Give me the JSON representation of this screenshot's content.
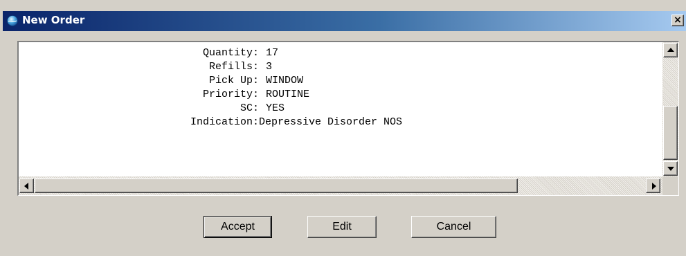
{
  "window": {
    "title": "New Order",
    "close_label": "×",
    "titlebar_gradient": [
      "#0a246a",
      "#3a6ea5",
      "#a6caf0"
    ],
    "face_color": "#d4d0c8"
  },
  "order_details": [
    {
      "label": "Quantity:",
      "value": "17"
    },
    {
      "label": "Refills:",
      "value": "3"
    },
    {
      "label": "Pick Up:",
      "value": "WINDOW"
    },
    {
      "label": "Priority:",
      "value": "ROUTINE"
    },
    {
      "label": "SC:",
      "value": "YES"
    },
    {
      "label": "Indication:",
      "value": "Depressive Disorder NOS"
    }
  ],
  "buttons": {
    "accept_label": "Accept",
    "edit_label": "Edit",
    "cancel_label": "Cancel"
  },
  "icons": {
    "title": "app-globe-icon",
    "close": "close-icon",
    "scroll_up": "arrow-up-icon",
    "scroll_down": "arrow-down-icon",
    "scroll_left": "arrow-left-icon",
    "scroll_right": "arrow-right-icon"
  }
}
